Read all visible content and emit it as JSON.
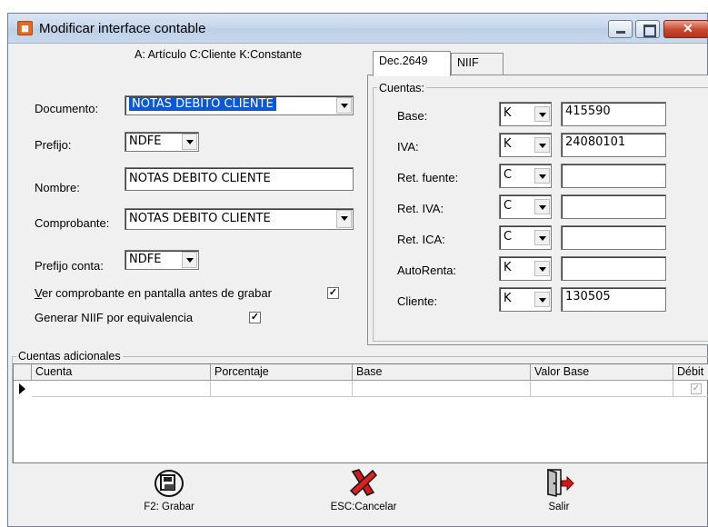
{
  "window": {
    "title": "Modificar interface contable",
    "icon": "app-icon"
  },
  "legend": "A: Artículo C:Cliente K:Constante",
  "form": {
    "documento_label": "Documento:",
    "documento_value": "NOTAS DEBITO CLIENTE",
    "prefijo_label": "Prefijo:",
    "prefijo_value": "NDFE",
    "nombre_label": "Nombre:",
    "nombre_value": "NOTAS DEBITO CLIENTE",
    "comprobante_label": "Comprobante:",
    "comprobante_value": "NOTAS DEBITO CLIENTE",
    "prefijo_conta_label": "Prefijo conta:",
    "prefijo_conta_value": "NDFE",
    "ver_comprobante_label": "Ver comprobante en pantalla antes de grabar",
    "ver_comprobante_checked": true,
    "generar_niif_label": "Generar  NIIF por equivalencia",
    "generar_niif_checked": true
  },
  "tabs": [
    {
      "label": "Dec.2649",
      "active": true
    },
    {
      "label": "NIIF",
      "active": false
    }
  ],
  "cuentas": {
    "title": "Cuentas:",
    "rows": [
      {
        "label": "Base:",
        "tipo": "K",
        "cuenta": "415590"
      },
      {
        "label": "IVA:",
        "tipo": "K",
        "cuenta": "24080101"
      },
      {
        "label": "Ret. fuente:",
        "tipo": "C",
        "cuenta": ""
      },
      {
        "label": "Ret. IVA:",
        "tipo": "C",
        "cuenta": ""
      },
      {
        "label": "Ret. ICA:",
        "tipo": "C",
        "cuenta": ""
      },
      {
        "label": "AutoRenta:",
        "tipo": "K",
        "cuenta": ""
      },
      {
        "label": "Cliente:",
        "tipo": "K",
        "cuenta": "130505"
      }
    ]
  },
  "adicionales": {
    "title": "Cuentas adicionales",
    "columns": [
      "Cuenta",
      "Porcentaje",
      "Base",
      "Valor Base",
      "Débit"
    ],
    "row_debito_checked": true
  },
  "toolbar": {
    "grabar_label": "F2: Grabar",
    "cancelar_label": "ESC:Cancelar",
    "salir_label": "Salir"
  }
}
